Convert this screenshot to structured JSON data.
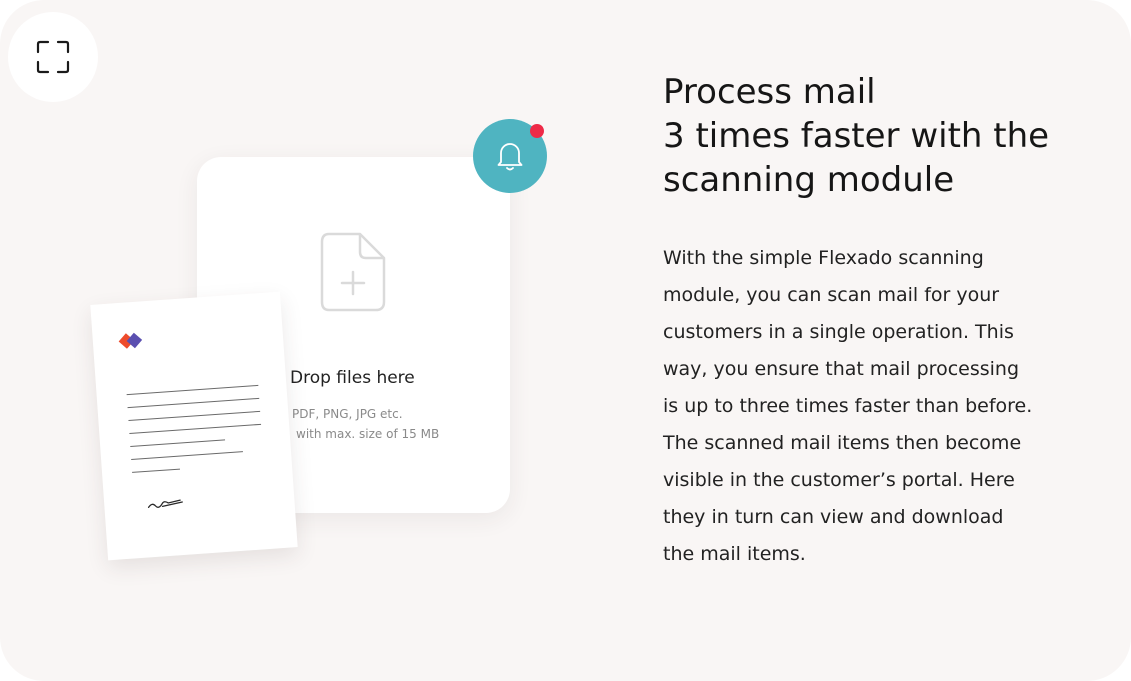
{
  "accent": {
    "teal": "#4fb4c1",
    "notification_red": "#ee2a47",
    "card_background": "#f9f6f5"
  },
  "icons": {
    "fullscreen": "fullscreen-corners-icon",
    "bell": "bell-icon",
    "file_add": "file-plus-icon",
    "logo": "flexado-logo"
  },
  "upload": {
    "title": "Drop files here",
    "formats": "PDF, PNG, JPG etc.",
    "size_limit": "with max. size of 15 MB"
  },
  "hero": {
    "heading_lines": [
      "Process mail",
      "3 times faster with the",
      "scanning module"
    ],
    "body_lines": [
      "With the simple Flexado scanning",
      "module, you can scan mail for your",
      "customers in a single operation. This",
      "way, you ensure that mail processing",
      "is up to three times faster than before.",
      "The scanned mail items then become",
      "visible in the customer’s portal. Here",
      "they in turn can view and download",
      "the mail items."
    ]
  }
}
